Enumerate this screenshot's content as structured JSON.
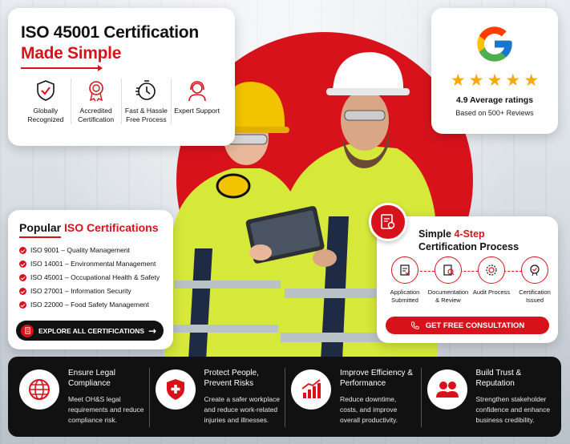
{
  "hero": {
    "title_line1": "ISO 45001 Certification",
    "title_line2": "Made Simple",
    "features": [
      {
        "icon": "shield-check-icon",
        "label": "Globally Recognized"
      },
      {
        "icon": "award-ribbon-icon",
        "label": "Accredited Certification"
      },
      {
        "icon": "stopwatch-icon",
        "label": "Fast & Hassle Free Process"
      },
      {
        "icon": "headset-support-icon",
        "label": "Expert Support"
      }
    ]
  },
  "rating": {
    "brand_icon": "google-g-icon",
    "stars": 5,
    "average": "4.9 Average ratings",
    "based_on": "Based on 500+ Reviews"
  },
  "popular": {
    "title_prefix": "Popular ",
    "title_highlight": "ISO Certifications",
    "items": [
      "ISO 9001 – Quality Management",
      "ISO 14001 – Environmental Management",
      "ISO 45001 – Occupational Health & Safety",
      "ISO 27001 – Information Security",
      "ISO 22000 – Food Safety Management"
    ],
    "button": "EXPLORE ALL CERTIFICATIONS"
  },
  "steps": {
    "title_prefix": "Simple ",
    "title_highlight": "4-Step",
    "title_line2": "Certification Process",
    "items": [
      {
        "icon": "application-doc-icon",
        "label": "Application Submitted"
      },
      {
        "icon": "documentation-review-icon",
        "label": "Documentation & Review"
      },
      {
        "icon": "audit-gear-icon",
        "label": "Audit Process"
      },
      {
        "icon": "certificate-seal-icon",
        "label": "Certification Issued"
      }
    ],
    "button": "GET FREE CONSULTATION"
  },
  "benefits": [
    {
      "icon": "globe-icon",
      "title": "Ensure Legal Compliance",
      "text": "Meet OH&S legal requirements and reduce compliance risk."
    },
    {
      "icon": "shield-cross-icon",
      "title": "Protect People, Prevent Risks",
      "text": "Create a safer workplace and reduce work-related injuries and illnesses."
    },
    {
      "icon": "growth-chart-icon",
      "title": "Improve Efficiency & Performance",
      "text": "Reduce downtime, costs, and improve overall productivity."
    },
    {
      "icon": "team-people-icon",
      "title": "Build Trust & Reputation",
      "text": "Strengthen stakeholder confidence and enhance business credibility."
    }
  ],
  "colors": {
    "accent": "#d8121b",
    "dark": "#111111",
    "star": "#f7a80a"
  }
}
